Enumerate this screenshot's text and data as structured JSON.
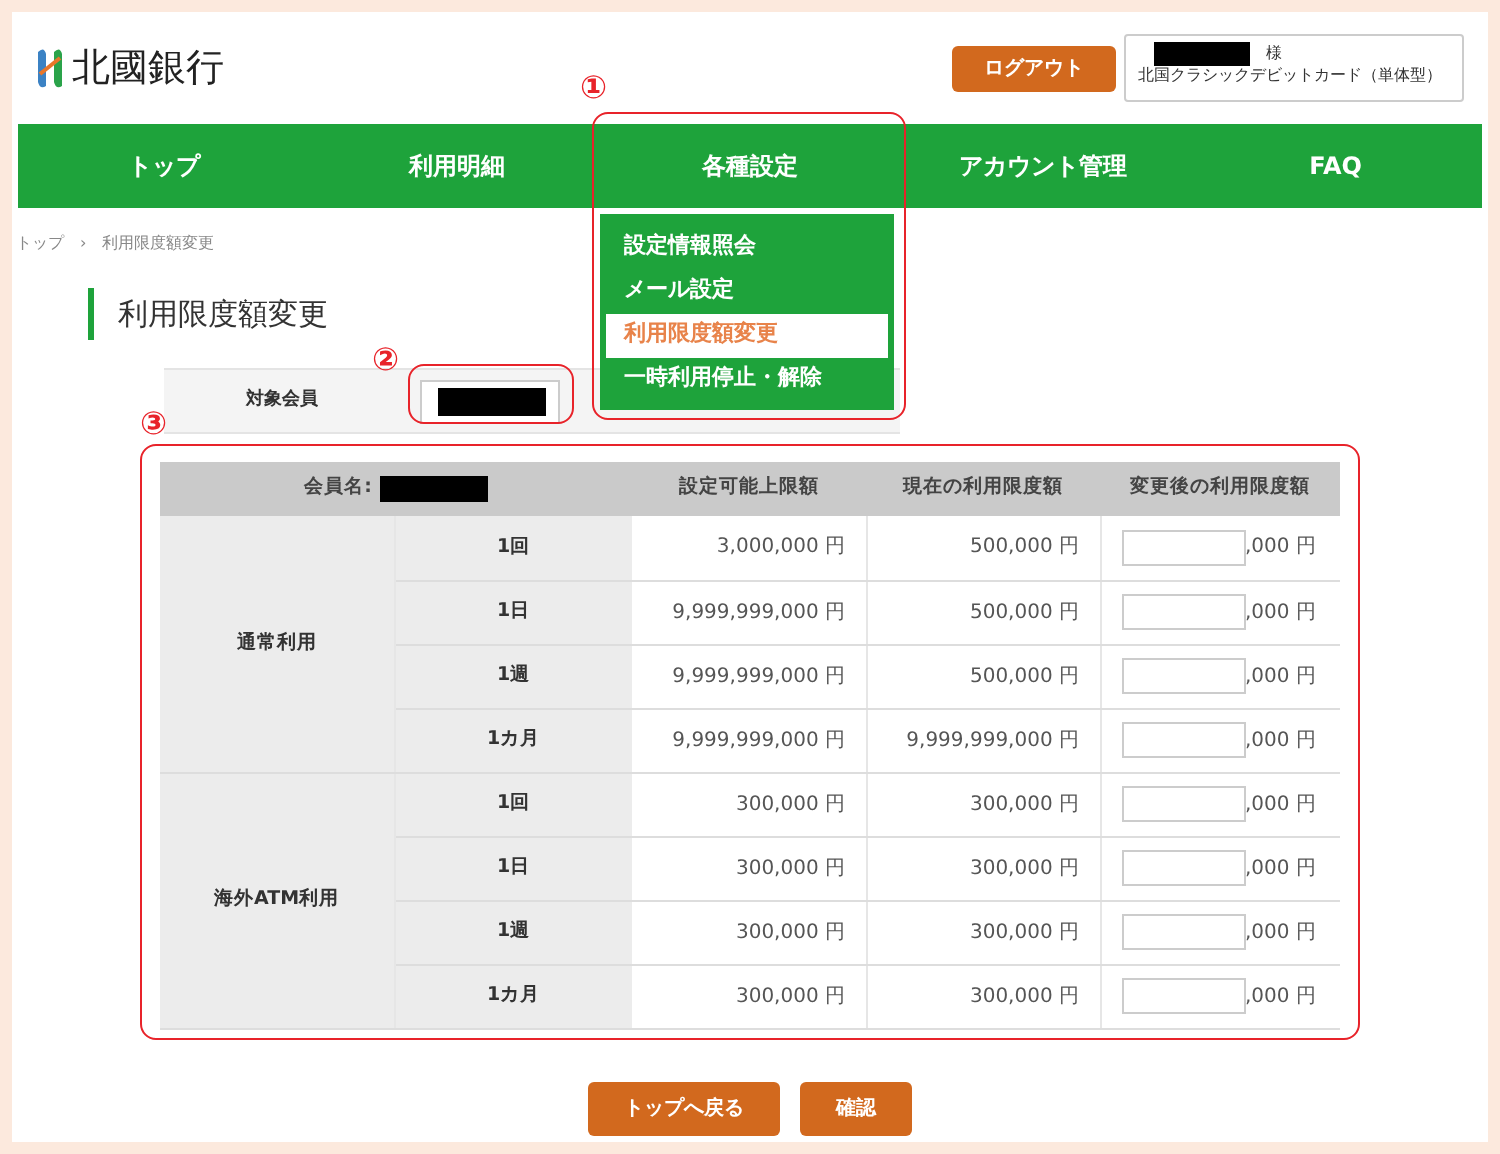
{
  "header": {
    "logo": "北國銀行",
    "logout_button": "ログアウト",
    "user": {
      "honorific": "様",
      "card": "北国クラシックデビットカード（単体型）"
    }
  },
  "nav": [
    {
      "label": "トップ"
    },
    {
      "label": "利用明細"
    },
    {
      "label": "各種設定",
      "expanded": true
    },
    {
      "label": "アカウント管理"
    },
    {
      "label": "FAQ"
    }
  ],
  "dropdown": [
    {
      "label": "設定情報照会",
      "selected": false
    },
    {
      "label": "メール設定",
      "selected": false
    },
    {
      "label": "利用限度額変更",
      "selected": true
    },
    {
      "label": "一時利用停止・解除",
      "selected": false
    }
  ],
  "breadcrumb": [
    "トップ",
    "›",
    "利用限度額変更"
  ],
  "title": "利用限度額変更",
  "member_field": {
    "label": "対象会員"
  },
  "table": {
    "columns": [
      "会員名:",
      "設定可能上限額",
      "現在の利用限度額",
      "変更後の利用限度額"
    ],
    "groups": [
      {
        "name": "通常利用",
        "rows": [
          {
            "period": "1回",
            "max": "3,000,000 円",
            "current": "500,000 円",
            "suffix": ",000 円"
          },
          {
            "period": "1日",
            "max": "9,999,999,000 円",
            "current": "500,000 円",
            "suffix": ",000 円"
          },
          {
            "period": "1週",
            "max": "9,999,999,000 円",
            "current": "500,000 円",
            "suffix": ",000 円"
          },
          {
            "period": "1カ月",
            "max": "9,999,999,000 円",
            "current": "9,999,999,000 円",
            "suffix": ",000 円"
          }
        ]
      },
      {
        "name": "海外ATM利用",
        "rows": [
          {
            "period": "1回",
            "max": "300,000 円",
            "current": "300,000 円",
            "suffix": ",000 円"
          },
          {
            "period": "1日",
            "max": "300,000 円",
            "current": "300,000 円",
            "suffix": ",000 円"
          },
          {
            "period": "1週",
            "max": "300,000 円",
            "current": "300,000 円",
            "suffix": ",000 円"
          },
          {
            "period": "1カ月",
            "max": "300,000 円",
            "current": "300,000 円",
            "suffix": ",000 円"
          }
        ]
      }
    ]
  },
  "buttons": [
    "トップへ戻る",
    "確認"
  ],
  "annotations": [
    "①",
    "②",
    "③"
  ]
}
